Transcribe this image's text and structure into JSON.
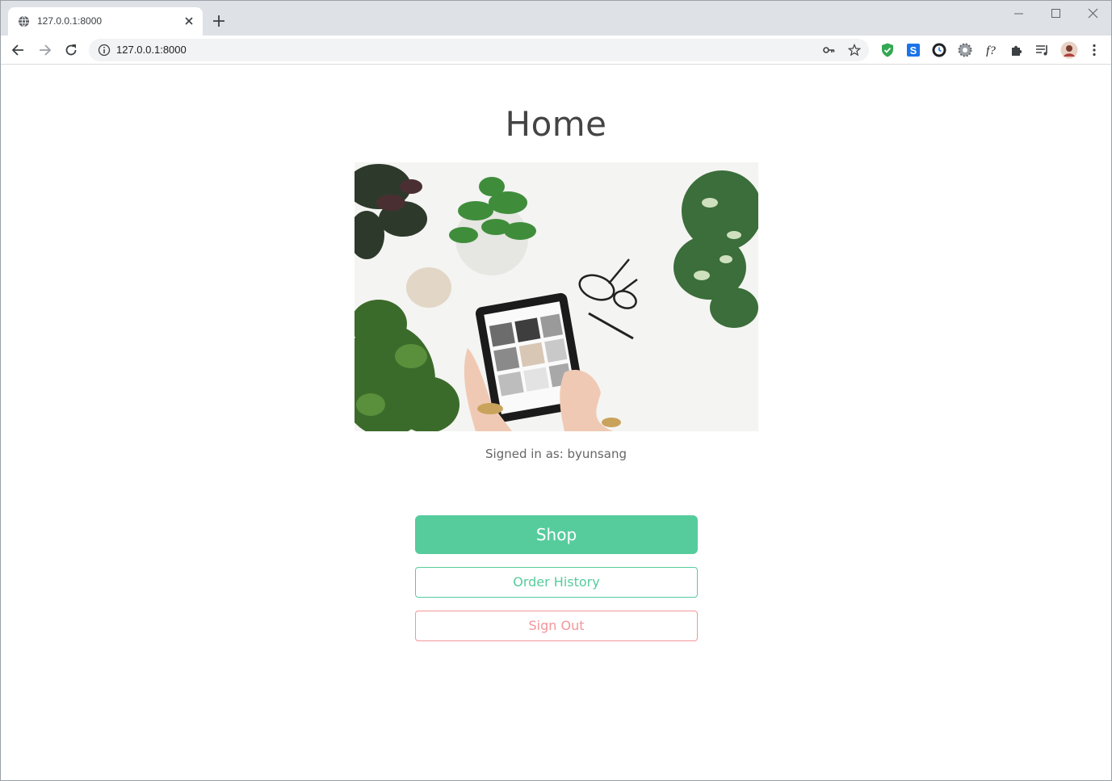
{
  "browser": {
    "tab_title": "127.0.0.1:8000",
    "url": "127.0.0.1:8000",
    "icons": {
      "favicon": "globe-icon",
      "tab_close": "close-icon",
      "new_tab": "plus-icon",
      "minimize": "minimize-icon",
      "maximize": "maximize-icon",
      "close_window": "close-icon",
      "back": "back-arrow-icon",
      "forward": "forward-arrow-icon",
      "reload": "reload-icon",
      "site_info": "info-icon",
      "password": "key-icon",
      "bookmark": "star-icon"
    },
    "extensions": [
      {
        "name": "shield-extension-icon",
        "color": "#34a853"
      },
      {
        "name": "s-extension-icon",
        "color": "#1a73e8",
        "glyph": "S"
      },
      {
        "name": "clock-extension-icon",
        "color": "#202124"
      },
      {
        "name": "gear-extension-icon",
        "color": "#5f6368"
      },
      {
        "name": "font-extension-icon",
        "color": "#202124",
        "glyph": "f?"
      },
      {
        "name": "puzzle-extension-icon",
        "color": "#5f6368"
      },
      {
        "name": "playlist-extension-icon",
        "color": "#5f6368"
      },
      {
        "name": "profile-avatar",
        "color": "#c89a84"
      },
      {
        "name": "menu-kebab-icon",
        "color": "#5f6368"
      }
    ]
  },
  "page": {
    "title": "Home",
    "hero_image": "tablet-with-plants-photo",
    "signed_in_text": "Signed in as: byunsang",
    "buttons": {
      "shop": "Shop",
      "order_history": "Order History",
      "sign_out": "Sign Out"
    },
    "colors": {
      "primary": "#56cc9d",
      "danger": "#f3969a",
      "heading": "#444444"
    }
  }
}
